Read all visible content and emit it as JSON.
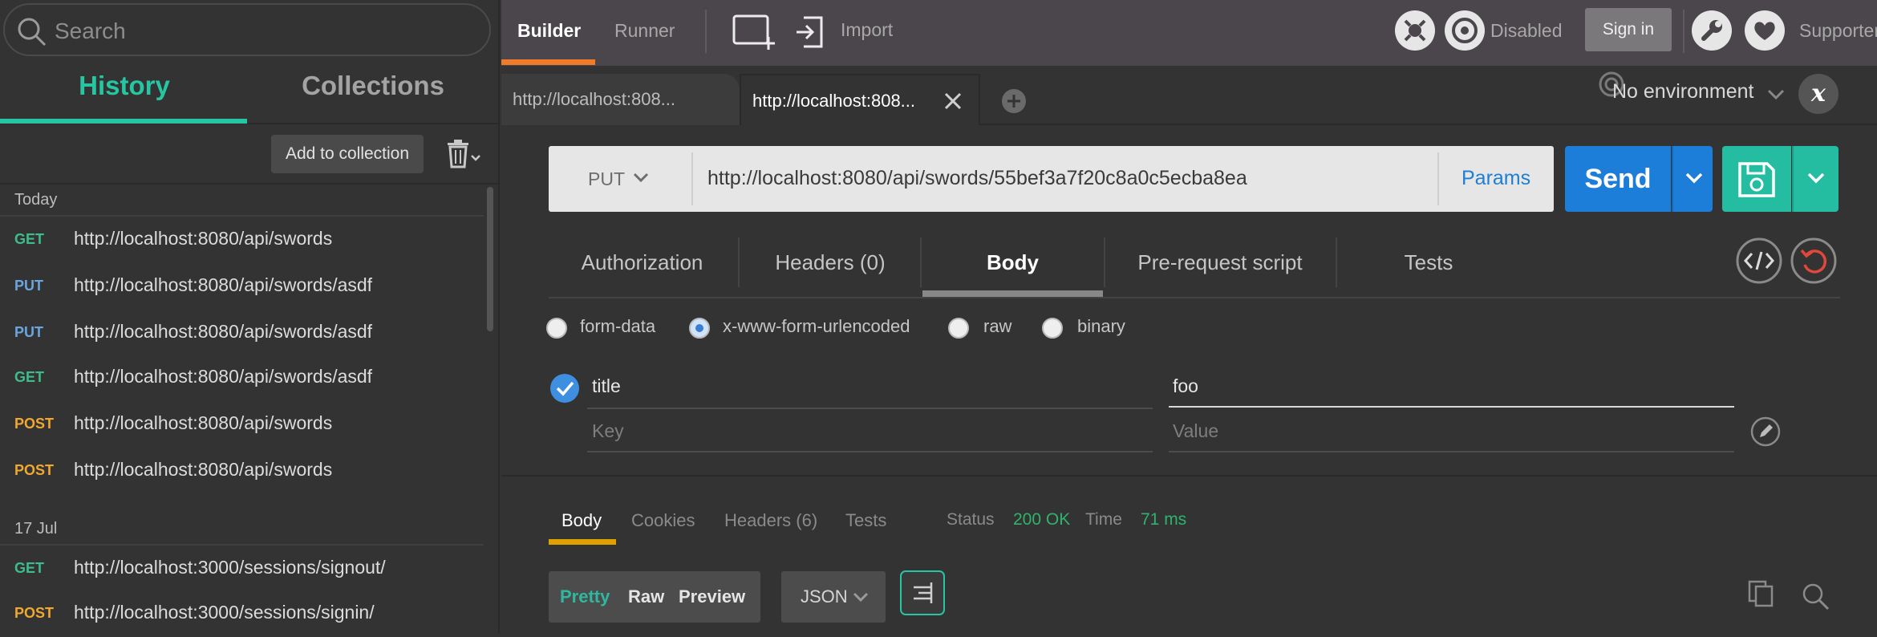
{
  "sidebar": {
    "search_placeholder": "Search",
    "tabs": [
      "History",
      "Collections"
    ],
    "add_to_collection": "Add to collection",
    "groups": [
      {
        "label": "Today",
        "items": [
          {
            "method": "GET",
            "url": "http://localhost:8080/api/swords"
          },
          {
            "method": "PUT",
            "url": "http://localhost:8080/api/swords/asdf"
          },
          {
            "method": "PUT",
            "url": "http://localhost:8080/api/swords/asdf"
          },
          {
            "method": "GET",
            "url": "http://localhost:8080/api/swords/asdf"
          },
          {
            "method": "POST",
            "url": "http://localhost:8080/api/swords"
          },
          {
            "method": "POST",
            "url": "http://localhost:8080/api/swords"
          }
        ]
      },
      {
        "label": "17 Jul",
        "items": [
          {
            "method": "GET",
            "url": "http://localhost:3000/sessions/signout/"
          },
          {
            "method": "POST",
            "url": "http://localhost:3000/sessions/signin/"
          }
        ]
      }
    ]
  },
  "topbar": {
    "builder": "Builder",
    "runner": "Runner",
    "import": "Import",
    "sync_status": "Disabled",
    "sign_in": "Sign in",
    "supporters": "Supporters"
  },
  "request_tabs": [
    {
      "title": "http://localhost:808..."
    },
    {
      "title": "http://localhost:808..."
    }
  ],
  "environment": {
    "selected": "No environment",
    "quicklook": "x"
  },
  "request": {
    "method": "PUT",
    "url": "http://localhost:8080/api/swords/55bef3a7f20c8a0c5ecba8ea",
    "params": "Params",
    "send": "Send"
  },
  "request_subtabs": [
    "Authorization",
    "Headers (0)",
    "Body",
    "Pre-request script",
    "Tests"
  ],
  "body_modes": [
    {
      "label": "form-data",
      "selected": false
    },
    {
      "label": "x-www-form-urlencoded",
      "selected": true
    },
    {
      "label": "raw",
      "selected": false
    },
    {
      "label": "binary",
      "selected": false
    }
  ],
  "kv": {
    "rows": [
      {
        "key": "title",
        "value": "foo",
        "checked": true
      }
    ],
    "key_placeholder": "Key",
    "value_placeholder": "Value"
  },
  "response": {
    "tabs": [
      "Body",
      "Cookies",
      "Headers (6)",
      "Tests"
    ],
    "status_label": "Status",
    "status_value": "200 OK",
    "time_label": "Time",
    "time_value": "71 ms",
    "views": [
      "Pretty",
      "Raw",
      "Preview"
    ],
    "format": "JSON"
  },
  "colors": {
    "history_accent": "#26c6a3",
    "send_blue": "#1c7ed9",
    "save_teal": "#25bda2",
    "builder_underline": "#f07b2b",
    "status_green": "#2fb36d",
    "get": "#3dbd8c",
    "put": "#6aa5e0",
    "post": "#f0a830"
  }
}
